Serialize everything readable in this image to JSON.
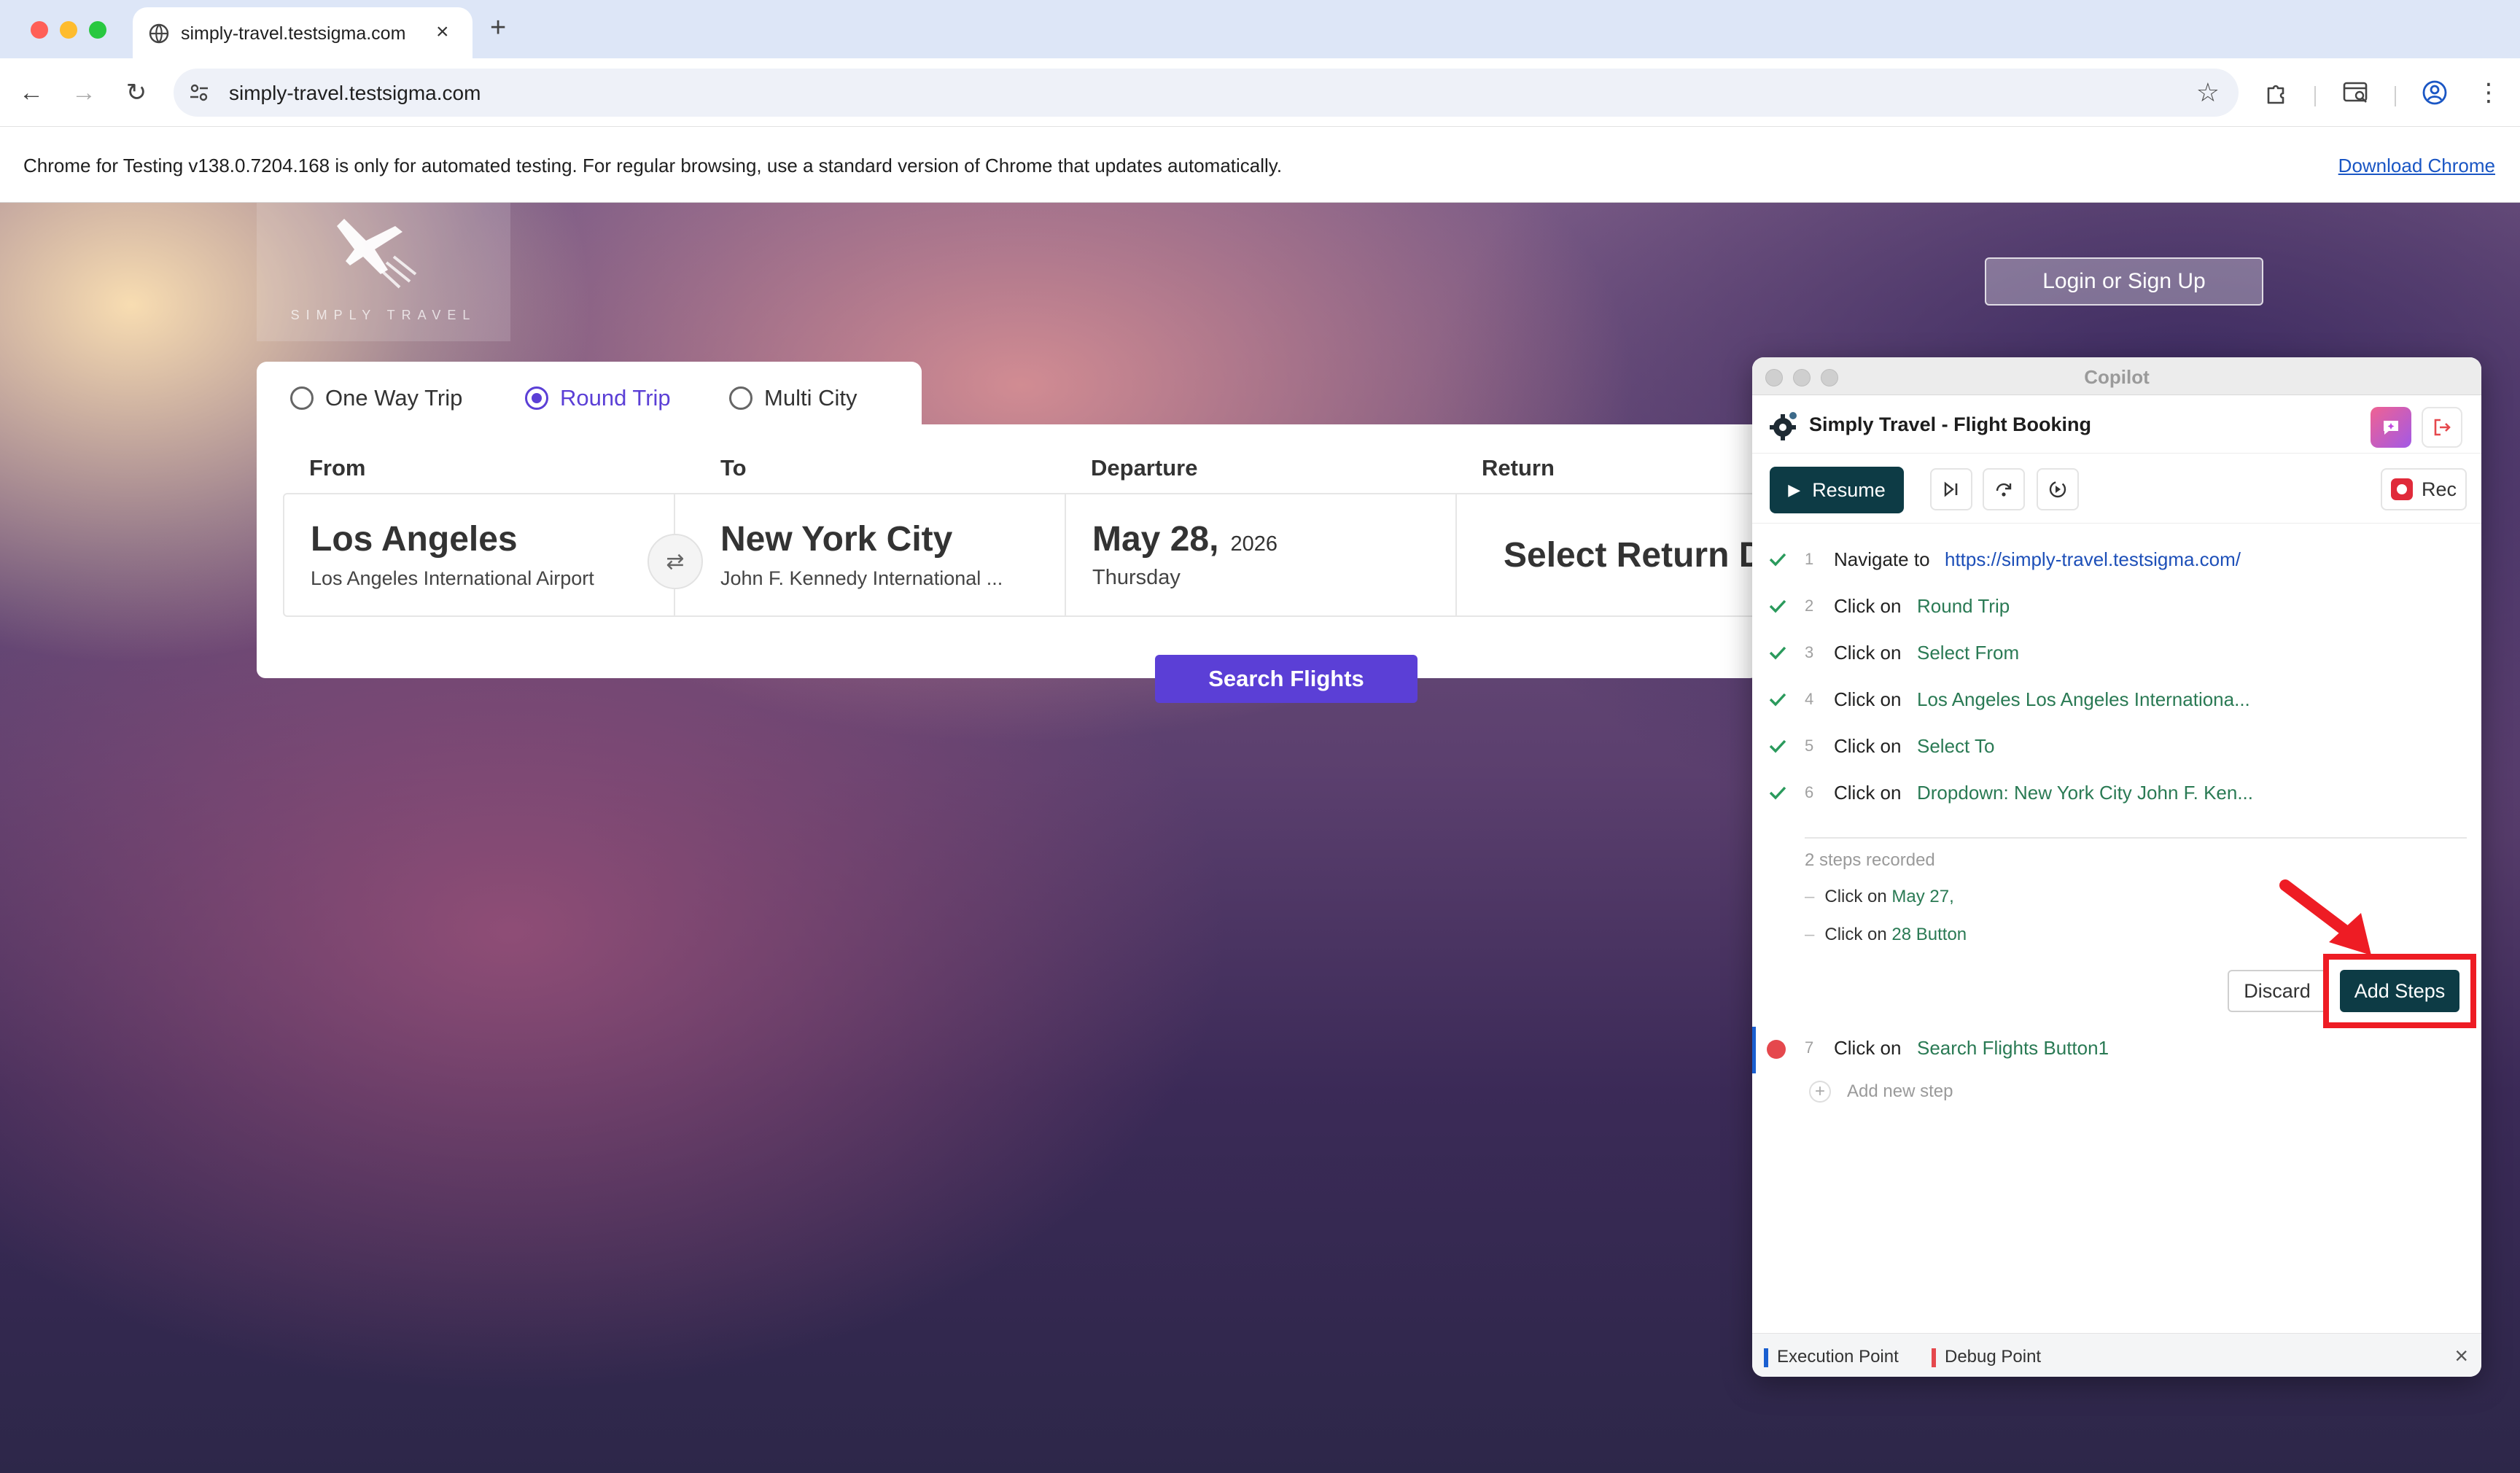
{
  "browser": {
    "tab_title": "simply-travel.testsigma.com",
    "url": "simply-travel.testsigma.com",
    "infobar_message": "Chrome for Testing v138.0.7204.168 is only for automated testing. For regular browsing, use a standard version of Chrome that updates automatically.",
    "download_link": "Download Chrome"
  },
  "site": {
    "logo_text": "SIMPLY TRAVEL",
    "login_label": "Login or Sign Up",
    "trip_types": [
      {
        "label": "One Way Trip",
        "selected": false
      },
      {
        "label": "Round Trip",
        "selected": true
      },
      {
        "label": "Multi City",
        "selected": false
      }
    ],
    "labels": {
      "from": "From",
      "to": "To",
      "departure": "Departure",
      "return": "Return"
    },
    "from": {
      "city": "Los Angeles",
      "airport": "Los Angeles International Airport"
    },
    "to": {
      "city": "New York City",
      "airport": "John F. Kennedy International ..."
    },
    "departure": {
      "date": "May 28,",
      "year": "2026",
      "day": "Thursday"
    },
    "return_placeholder": "Select Return Da",
    "search_button": "Search Flights",
    "accent_color": "#5b3fd6"
  },
  "copilot": {
    "window_title": "Copilot",
    "project_name": "Simply Travel - Flight Booking",
    "resume_label": "Resume",
    "rec_label": "Rec",
    "steps": [
      {
        "num": "1",
        "action": "Navigate to",
        "target": "https://simply-travel.testsigma.com/"
      },
      {
        "num": "2",
        "action": "Click on",
        "target": "Round Trip"
      },
      {
        "num": "3",
        "action": "Click on",
        "target": "Select From"
      },
      {
        "num": "4",
        "action": "Click on",
        "target": "Los Angeles Los Angeles Internationa..."
      },
      {
        "num": "5",
        "action": "Click on",
        "target": "Select To"
      },
      {
        "num": "6",
        "action": "Click on",
        "target": "Dropdown: New York City John F. Ken..."
      }
    ],
    "recorded_label": "2 steps recorded",
    "recorded": [
      {
        "action": "Click on",
        "target": "May 27,"
      },
      {
        "action": "Click on",
        "target": "28 Button"
      }
    ],
    "discard_label": "Discard",
    "add_steps_label": "Add Steps",
    "current_step": {
      "num": "7",
      "action": "Click on",
      "target": "Search Flights Button1"
    },
    "add_new_step": "Add new step",
    "legend_execution": "Execution Point",
    "legend_debug": "Debug Point",
    "primary_color": "#0d3b45",
    "step_target_color": "#2a7a54"
  },
  "annotation": {
    "highlight_color": "#ee1c24"
  }
}
